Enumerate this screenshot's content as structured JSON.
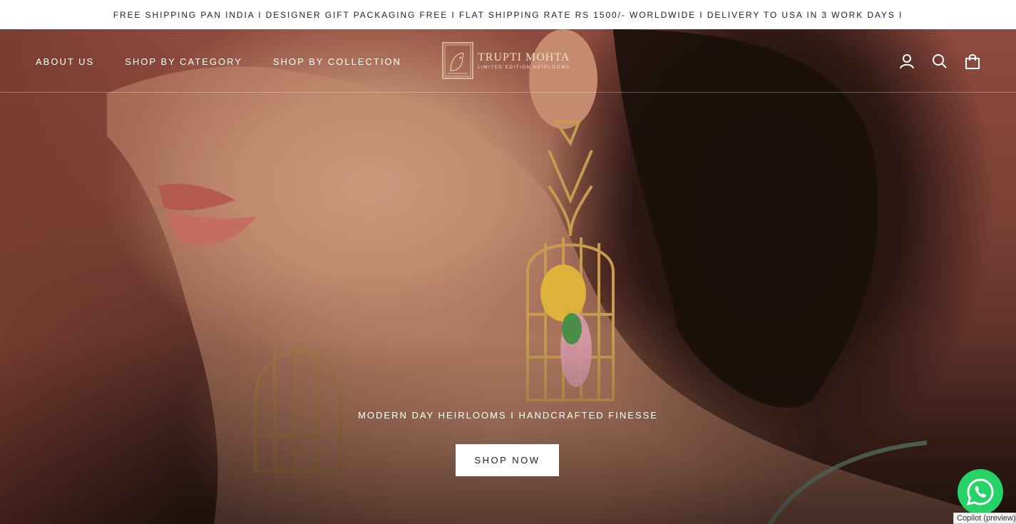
{
  "announcement": {
    "text": "FREE SHIPPING PAN INDIA I DESIGNER GIFT PACKAGING FREE I FLAT SHIPPING RATE RS 1500/- WORLDWIDE I DELIVERY TO USA IN 3 WORK DAYS I"
  },
  "nav": {
    "items": [
      {
        "label": "ABOUT US"
      },
      {
        "label": "SHOP BY CATEGORY"
      },
      {
        "label": "SHOP BY COLLECTION"
      }
    ]
  },
  "logo": {
    "name": "TRUPTI MOHTA",
    "tagline": "LIMITED EDITION HEIRLOOMS",
    "color": "#f1ddc8"
  },
  "header_icons": [
    "account-icon",
    "search-icon",
    "cart-icon"
  ],
  "hero": {
    "caption": "MODERN DAY HEIRLOOMS I HANDCRAFTED FINESSE",
    "cta_label": "SHOP NOW"
  },
  "widgets": {
    "whatsapp_icon": "whatsapp-icon",
    "whatsapp_color": "#25d366",
    "copilot_label": "Copilot (preview)"
  }
}
